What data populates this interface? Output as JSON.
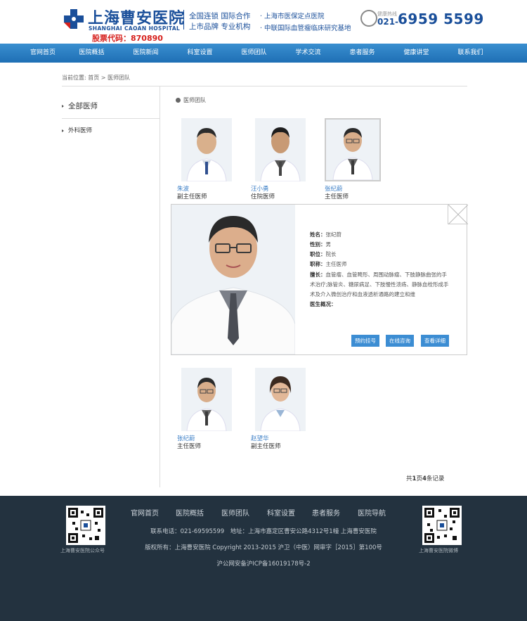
{
  "header": {
    "logo_cn": "上海曹安医院",
    "logo_en": "SHANGHAI CAOAN HOSPITAL",
    "stock": "股票代码：870890",
    "slogan1": "全国连锁 国际合作",
    "slogan2": "上市品牌 专业机构",
    "honor1": "· 上海市医保定点医院",
    "honor2": "· 中联国际血管瘤临床研究基地",
    "phone_label": "健康热线",
    "phone_area": "021-",
    "phone_number": "6959 5599"
  },
  "nav": [
    "官网首页",
    "医院概括",
    "医院新闻",
    "科室设置",
    "医师团队",
    "学术交流",
    "患者服务",
    "健康讲堂",
    "联系我们"
  ],
  "breadcrumb": {
    "prefix": "当前位置:",
    "home": "首页",
    "sep": ">",
    "current": "医师团队"
  },
  "sidebar": {
    "all": "全部医师",
    "surgery": "外科医师"
  },
  "section_title": "医师团队",
  "doctors_row1": [
    {
      "name": "朱波",
      "title": "副主任医师"
    },
    {
      "name": "汪小勇",
      "title": "住院医师"
    },
    {
      "name": "张纪蔚",
      "title": "主任医师"
    }
  ],
  "doctors_row2": [
    {
      "name": "张纪蔚",
      "title": "主任医师"
    },
    {
      "name": "赵望华",
      "title": "副主任医师"
    }
  ],
  "detail": {
    "name_label": "姓名：",
    "name": "张纪蔚",
    "gender_label": "性别：",
    "gender": "男",
    "position_label": "职位：",
    "position": "院长",
    "rank_label": "职称：",
    "rank": "主任医师",
    "specialty_label": "擅长：",
    "specialty": "血管瘤、血管畸形、周围动脉瘤、下肢静脉曲张的手术治疗;脉管炎、糖尿病足、下肢慢性溃疡、静脉血栓形成手术及介入微创治疗和血液透析通路的建立和维",
    "profile_label": "医生概况：",
    "btn_book": "预约挂号",
    "btn_consult": "在线咨询",
    "btn_detail": "查看详细"
  },
  "pager": {
    "pre": "共",
    "pages": "1",
    "mid": "页",
    "count": "4",
    "post": "条记录"
  },
  "footer": {
    "nav": [
      "官网首页",
      "医院概括",
      "医师团队",
      "科室设置",
      "患者服务",
      "医院导航"
    ],
    "contact": "联系电话：021-69595599　地址：上海市嘉定区曹安公路4312号1幢 上海曹安医院",
    "copyright": "版权所有：上海曹安医院 Copyright 2013-2015 沪卫（中医）网审字［2015］第100号",
    "icp": "沪公网安备沪ICP备16019178号-2",
    "qr_left_label": "上海曹安医院公众号",
    "qr_right_label": "上海曹安医院微博"
  },
  "colors": {
    "brand": "#1a4f9a",
    "nav": "#2a7fc4",
    "stock": "#d6201c",
    "link": "#3a7ec6",
    "footer": "#23323f"
  }
}
